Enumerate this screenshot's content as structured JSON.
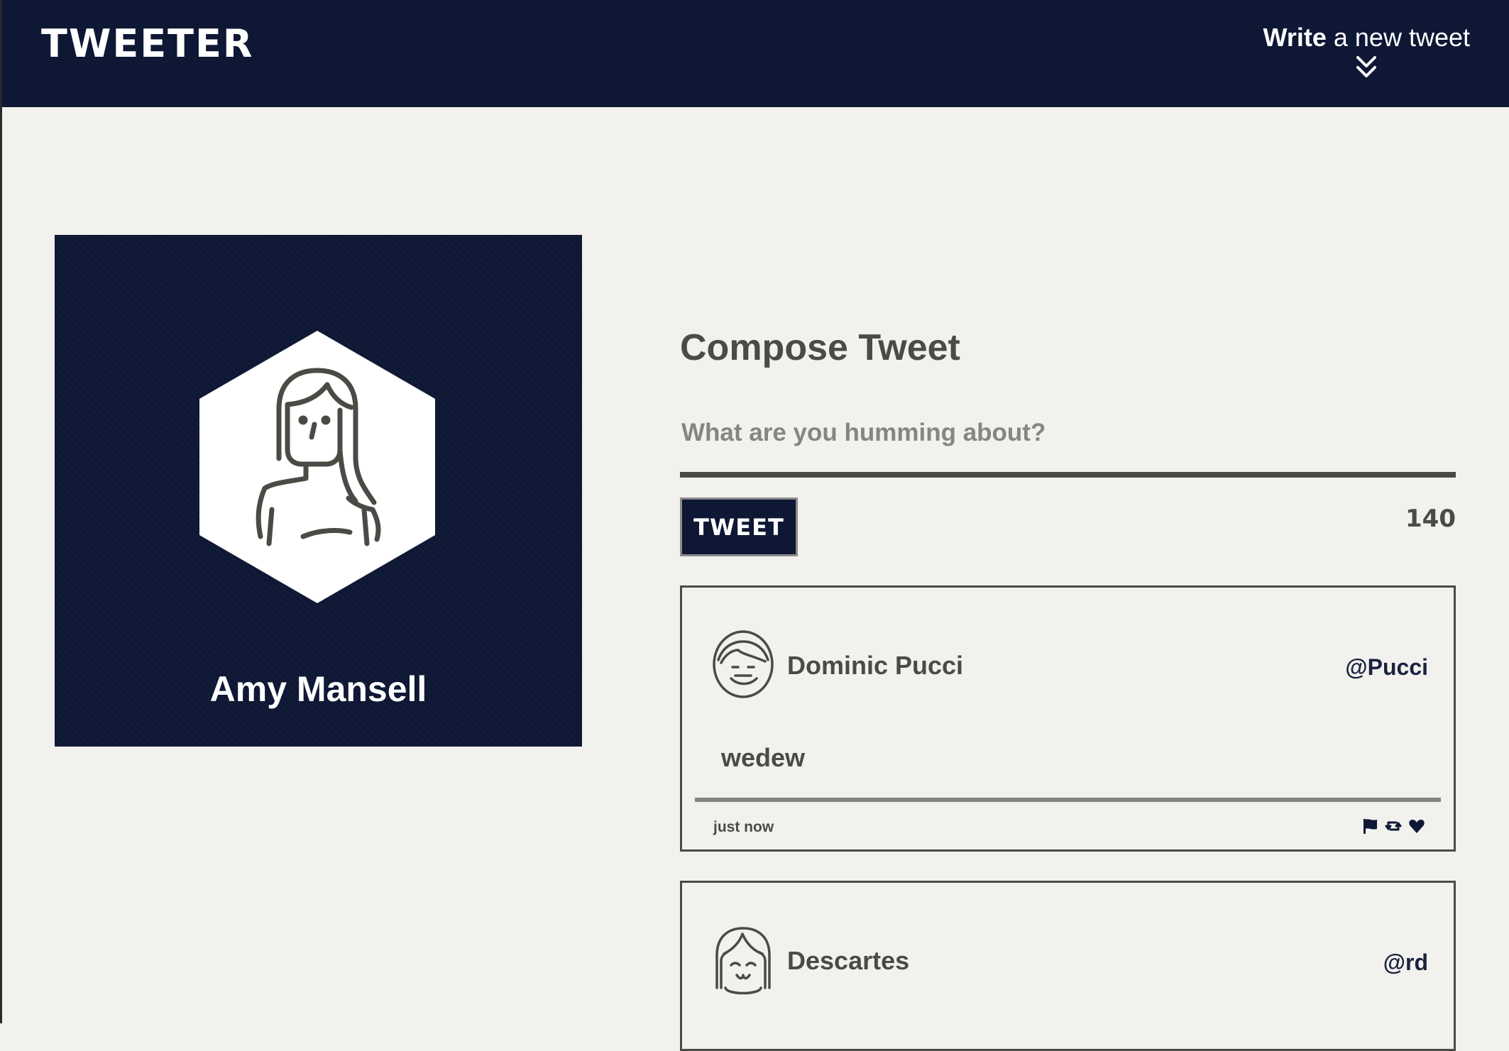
{
  "nav": {
    "logo": "TWEETER",
    "write_bold": "Write",
    "write_rest": " a new tweet",
    "toggle_icon": "double-chevron-down-icon"
  },
  "profile": {
    "name": "Amy Mansell",
    "avatar_icon": "woman-avatar-icon"
  },
  "compose": {
    "title": "Compose Tweet",
    "placeholder": "What are you humming about?",
    "value": "",
    "button_label": "TWEET",
    "counter": "140"
  },
  "tweets": [
    {
      "name": "Dominic Pucci",
      "handle": "@Pucci",
      "text": "wedew",
      "time": "just now",
      "avatar_icon": "smiling-man-avatar-icon",
      "actions": [
        "flag-icon",
        "retweet-icon",
        "heart-icon"
      ]
    },
    {
      "name": "Descartes",
      "handle": "@rd",
      "avatar_icon": "girl-avatar-icon"
    }
  ],
  "colors": {
    "navy": "#0e1734",
    "background": "#f2f1ed",
    "text": "#4b4a44"
  }
}
